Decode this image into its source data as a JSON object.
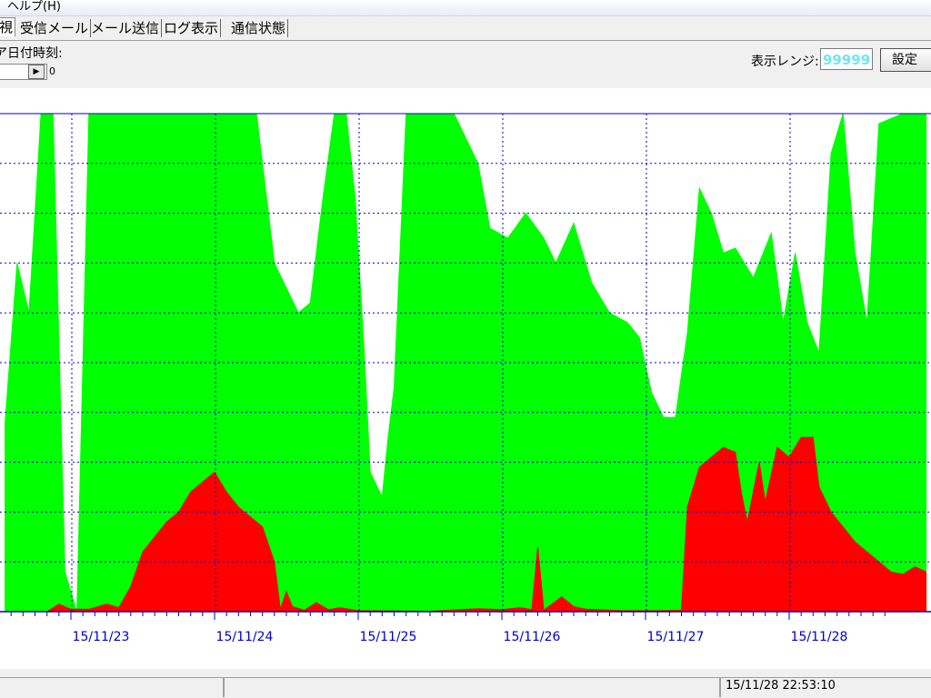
{
  "menu": {
    "help": "ヘルプ(H)"
  },
  "tabs": [
    {
      "label": "視"
    },
    {
      "label": "受信メール"
    },
    {
      "label": "メール送信"
    },
    {
      "label": "ログ表示"
    },
    {
      "label": "通信状態"
    }
  ],
  "controls": {
    "date_label": "ア日付時刻:",
    "scroll_value": "0",
    "range_label": "表示レンジ:",
    "range_value": "99999",
    "set_button": "設定"
  },
  "chart_data": {
    "type": "area",
    "x_tick_labels": [
      "15/11/23",
      "15/11/24",
      "15/11/25",
      "15/11/26",
      "15/11/27",
      "15/11/28"
    ],
    "grid": true,
    "ylim": [
      0,
      99999
    ],
    "series": [
      {
        "color": "#00ff00",
        "points": [
          [
            "15/11/22 13:00",
            38000
          ],
          [
            "15/11/22 15:00",
            70000
          ],
          [
            "15/11/22 17:00",
            60000
          ],
          [
            "15/11/22 19:00",
            99999
          ],
          [
            "15/11/22 21:00",
            99999
          ],
          [
            "15/11/22 23:00",
            8000
          ],
          [
            "15/11/23 01:00",
            0
          ],
          [
            "15/11/23 03:00",
            99999
          ],
          [
            "15/11/23 07:00",
            99999
          ],
          [
            "15/11/23 12:00",
            99999
          ],
          [
            "15/11/23 18:00",
            99999
          ],
          [
            "15/11/24 01:00",
            99999
          ],
          [
            "15/11/24 07:00",
            99999
          ],
          [
            "15/11/24 10:00",
            70000
          ],
          [
            "15/11/24 12:00",
            65000
          ],
          [
            "15/11/24 14:00",
            60000
          ],
          [
            "15/11/24 16:00",
            62000
          ],
          [
            "15/11/24 18:00",
            82000
          ],
          [
            "15/11/24 20:00",
            99999
          ],
          [
            "15/11/24 22:00",
            99999
          ],
          [
            "15/11/24 23:30",
            83000
          ],
          [
            "15/11/25 01:00",
            52000
          ],
          [
            "15/11/25 02:00",
            28000
          ],
          [
            "15/11/25 04:00",
            23000
          ],
          [
            "15/11/25 05:00",
            35000
          ],
          [
            "15/11/25 06:00",
            45000
          ],
          [
            "15/11/25 08:00",
            99999
          ],
          [
            "15/11/25 12:00",
            99999
          ],
          [
            "15/11/25 16:00",
            99999
          ],
          [
            "15/11/25 20:00",
            90000
          ],
          [
            "15/11/25 22:00",
            77000
          ],
          [
            "15/11/26 01:00",
            75000
          ],
          [
            "15/11/26 04:00",
            80000
          ],
          [
            "15/11/26 07:00",
            75000
          ],
          [
            "15/11/26 09:00",
            70000
          ],
          [
            "15/11/26 12:00",
            78000
          ],
          [
            "15/11/26 15:00",
            66000
          ],
          [
            "15/11/26 18:00",
            60000
          ],
          [
            "15/11/26 21:00",
            58000
          ],
          [
            "15/11/26 23:00",
            55000
          ],
          [
            "15/11/27 01:00",
            44000
          ],
          [
            "15/11/27 03:00",
            39000
          ],
          [
            "15/11/27 05:00",
            39000
          ],
          [
            "15/11/27 07:00",
            56000
          ],
          [
            "15/11/27 09:00",
            85000
          ],
          [
            "15/11/27 11:00",
            80000
          ],
          [
            "15/11/27 13:00",
            72000
          ],
          [
            "15/11/27 15:00",
            73000
          ],
          [
            "15/11/27 18:00",
            67000
          ],
          [
            "15/11/27 21:00",
            76000
          ],
          [
            "15/11/27 23:00",
            58000
          ],
          [
            "15/11/28 01:00",
            72000
          ],
          [
            "15/11/28 03:00",
            58000
          ],
          [
            "15/11/28 05:00",
            52000
          ],
          [
            "15/11/28 07:00",
            92000
          ],
          [
            "15/11/28 09:00",
            99999
          ],
          [
            "15/11/28 11:00",
            72000
          ],
          [
            "15/11/28 13:00",
            58000
          ],
          [
            "15/11/28 15:00",
            98000
          ],
          [
            "15/11/28 19:00",
            99999
          ],
          [
            "15/11/28 22:53",
            99999
          ]
        ]
      },
      {
        "color": "#ff0000",
        "points": [
          [
            "15/11/22 13:00",
            0
          ],
          [
            "15/11/22 20:00",
            0
          ],
          [
            "15/11/22 22:00",
            1500
          ],
          [
            "15/11/23 00:00",
            500
          ],
          [
            "15/11/23 03:00",
            500
          ],
          [
            "15/11/23 06:00",
            1500
          ],
          [
            "15/11/23 08:00",
            800
          ],
          [
            "15/11/23 10:00",
            5000
          ],
          [
            "15/11/23 12:00",
            12000
          ],
          [
            "15/11/23 14:00",
            15000
          ],
          [
            "15/11/23 16:00",
            18000
          ],
          [
            "15/11/23 18:00",
            20000
          ],
          [
            "15/11/23 20:00",
            24000
          ],
          [
            "15/11/23 22:00",
            26000
          ],
          [
            "15/11/24 00:00",
            28000
          ],
          [
            "15/11/24 02:00",
            24000
          ],
          [
            "15/11/24 04:00",
            21000
          ],
          [
            "15/11/24 06:00",
            19000
          ],
          [
            "15/11/24 08:00",
            17000
          ],
          [
            "15/11/24 10:00",
            10000
          ],
          [
            "15/11/24 11:00",
            500
          ],
          [
            "15/11/24 12:00",
            4000
          ],
          [
            "15/11/24 13:00",
            1000
          ],
          [
            "15/11/24 15:00",
            300
          ],
          [
            "15/11/24 17:00",
            1800
          ],
          [
            "15/11/24 19:00",
            400
          ],
          [
            "15/11/24 21:00",
            800
          ],
          [
            "15/11/25 00:00",
            200
          ],
          [
            "15/11/25 12:00",
            100
          ],
          [
            "15/11/25 20:00",
            600
          ],
          [
            "15/11/26 00:00",
            400
          ],
          [
            "15/11/26 03:00",
            800
          ],
          [
            "15/11/26 05:00",
            400
          ],
          [
            "15/11/26 06:00",
            13000
          ],
          [
            "15/11/26 07:00",
            300
          ],
          [
            "15/11/26 10:00",
            3000
          ],
          [
            "15/11/26 12:00",
            1000
          ],
          [
            "15/11/26 14:00",
            500
          ],
          [
            "15/11/26 20:00",
            200
          ],
          [
            "15/11/27 03:00",
            200
          ],
          [
            "15/11/27 06:00",
            300
          ],
          [
            "15/11/27 07:00",
            21000
          ],
          [
            "15/11/27 09:00",
            29000
          ],
          [
            "15/11/27 11:00",
            31000
          ],
          [
            "15/11/27 13:00",
            33000
          ],
          [
            "15/11/27 15:00",
            32000
          ],
          [
            "15/11/27 16:00",
            24000
          ],
          [
            "15/11/27 17:00",
            18000
          ],
          [
            "15/11/27 19:00",
            30000
          ],
          [
            "15/11/27 20:00",
            22000
          ],
          [
            "15/11/27 22:00",
            33000
          ],
          [
            "15/11/28 00:00",
            31000
          ],
          [
            "15/11/28 02:00",
            35000
          ],
          [
            "15/11/28 04:00",
            35000
          ],
          [
            "15/11/28 05:00",
            25000
          ],
          [
            "15/11/28 07:00",
            20000
          ],
          [
            "15/11/28 09:00",
            17000
          ],
          [
            "15/11/28 11:00",
            14000
          ],
          [
            "15/11/28 13:00",
            12000
          ],
          [
            "15/11/28 15:00",
            10000
          ],
          [
            "15/11/28 17:00",
            8000
          ],
          [
            "15/11/28 19:00",
            7500
          ],
          [
            "15/11/28 21:00",
            9000
          ],
          [
            "15/11/28 22:53",
            8000
          ]
        ]
      }
    ]
  },
  "status": {
    "clock": "15/11/28 22:53:10"
  }
}
